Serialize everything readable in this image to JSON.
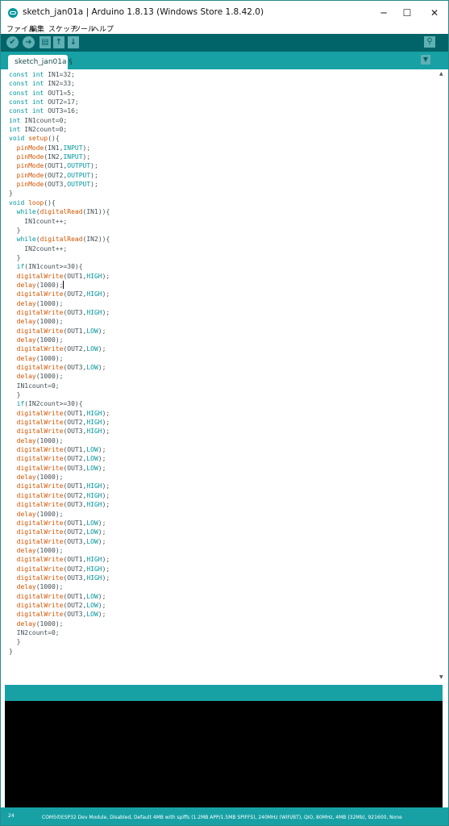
{
  "window": {
    "title": "sketch_jan01a | Arduino 1.8.13 (Windows Store 1.8.42.0)",
    "minimize_glyph": "─",
    "maximize_glyph": "☐",
    "close_glyph": "✕"
  },
  "menu": [
    "ファイル",
    "編集",
    "スケッチ",
    "ツール",
    "ヘルプ"
  ],
  "toolbar": {
    "verify_glyph": "✔",
    "upload_glyph": "➜",
    "new_glyph": "▤",
    "open_glyph": "↑",
    "save_glyph": "↓",
    "serial_glyph": "⚲"
  },
  "tabs": [
    {
      "label": "sketch_jan01a §"
    }
  ],
  "tab_menu_glyph": "▼",
  "scroll": {
    "up": "▲",
    "down": "▼"
  },
  "code": [
    "const int IN1=32;",
    "const int IN2=33;",
    "const int OUT1=5;",
    "const int OUT2=17;",
    "const int OUT3=16;",
    "int IN1count=0;",
    "int IN2count=0;",
    "void setup(){",
    "  pinMode(IN1,INPUT);",
    "  pinMode(IN2,INPUT);",
    "  pinMode(OUT1,OUTPUT);",
    "  pinMode(OUT2,OUTPUT);",
    "  pinMode(OUT3,OUTPUT);",
    "}",
    "void loop(){",
    "  while(digitalRead(IN1)){",
    "    IN1count++;",
    "  }",
    "  while(digitalRead(IN2)){",
    "    IN2count++;",
    "  }",
    "  if(IN1count>=30){",
    "  digitalWrite(OUT1,HIGH);",
    "  delay(1000);",
    "  digitalWrite(OUT2,HIGH);",
    "  delay(1000);",
    "  digitalWrite(OUT3,HIGH);",
    "  delay(1000);",
    "  digitalWrite(OUT1,LOW);",
    "  delay(1000);",
    "  digitalWrite(OUT2,LOW);",
    "  delay(1000);",
    "  digitalWrite(OUT3,LOW);",
    "  delay(1000);",
    "  IN1count=0;",
    "  }",
    "  if(IN2count>=30){",
    "  digitalWrite(OUT1,HIGH);",
    "  digitalWrite(OUT2,HIGH);",
    "  digitalWrite(OUT3,HIGH);",
    "  delay(1000);",
    "  digitalWrite(OUT1,LOW);",
    "  digitalWrite(OUT2,LOW);",
    "  digitalWrite(OUT3,LOW);",
    "  delay(1000);",
    "  digitalWrite(OUT1,HIGH);",
    "  digitalWrite(OUT2,HIGH);",
    "  digitalWrite(OUT3,HIGH);",
    "  delay(1000);",
    "  digitalWrite(OUT1,LOW);",
    "  digitalWrite(OUT2,LOW);",
    "  digitalWrite(OUT3,LOW);",
    "  delay(1000);",
    "  digitalWrite(OUT1,HIGH);",
    "  digitalWrite(OUT2,HIGH);",
    "  digitalWrite(OUT3,HIGH);",
    "  delay(1000);",
    "  digitalWrite(OUT1,LOW);",
    "  digitalWrite(OUT2,LOW);",
    "  digitalWrite(OUT3,LOW);",
    "  delay(1000);",
    "  IN2count=0;",
    "  }",
    "}"
  ],
  "cursor_line": 24,
  "status": {
    "line_number": "24",
    "board": "COM5のESP32 Dev Module, Disabled, Default 4MB with spiffs (1.2MB APP/1.5MB SPIFFS), 240MHz (WiFi/BT), QIO, 80MHz, 4MB (32Mb), 921600, None"
  },
  "syntax_colors": {
    "keyword": "#00979c",
    "function": "#d35400",
    "text": "#434f54"
  },
  "theme_colors": {
    "toolbar": "#006468",
    "tabbar": "#17a1a5",
    "console": "#000000"
  }
}
